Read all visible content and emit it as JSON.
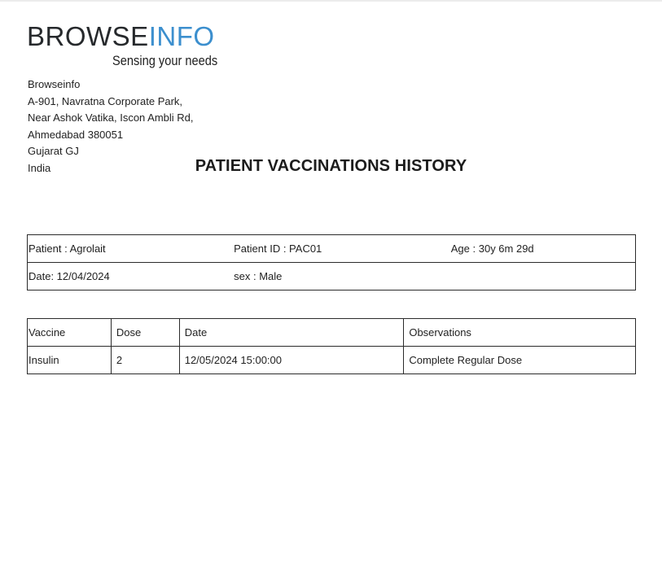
{
  "logo": {
    "word_dark": "BROWSE",
    "word_blue": "INFO",
    "tagline": "Sensing your needs",
    "colors": {
      "dark": "#26292c",
      "blue": "#3c8fce"
    }
  },
  "company": {
    "address_lines": [
      "Browseinfo",
      "A-901, Navratna Corporate Park,",
      "Near Ashok Vatika, Iscon Ambli Rd,",
      "Ahmedabad 380051",
      "Gujarat GJ",
      "India"
    ]
  },
  "document": {
    "title": "PATIENT VACCINATIONS HISTORY"
  },
  "patient_info": {
    "patient": "Patient : Agrolait",
    "patient_id": "Patient ID : PAC01",
    "age": "Age : 30y 6m 29d",
    "date": "Date: 12/04/2024",
    "sex": "sex : Male"
  },
  "vaccinations": {
    "headers": [
      "Vaccine",
      "Dose",
      "Date",
      "Observations"
    ],
    "rows": [
      [
        "Insulin",
        "2",
        "12/05/2024 15:00:00",
        "Complete Regular Dose"
      ]
    ]
  }
}
